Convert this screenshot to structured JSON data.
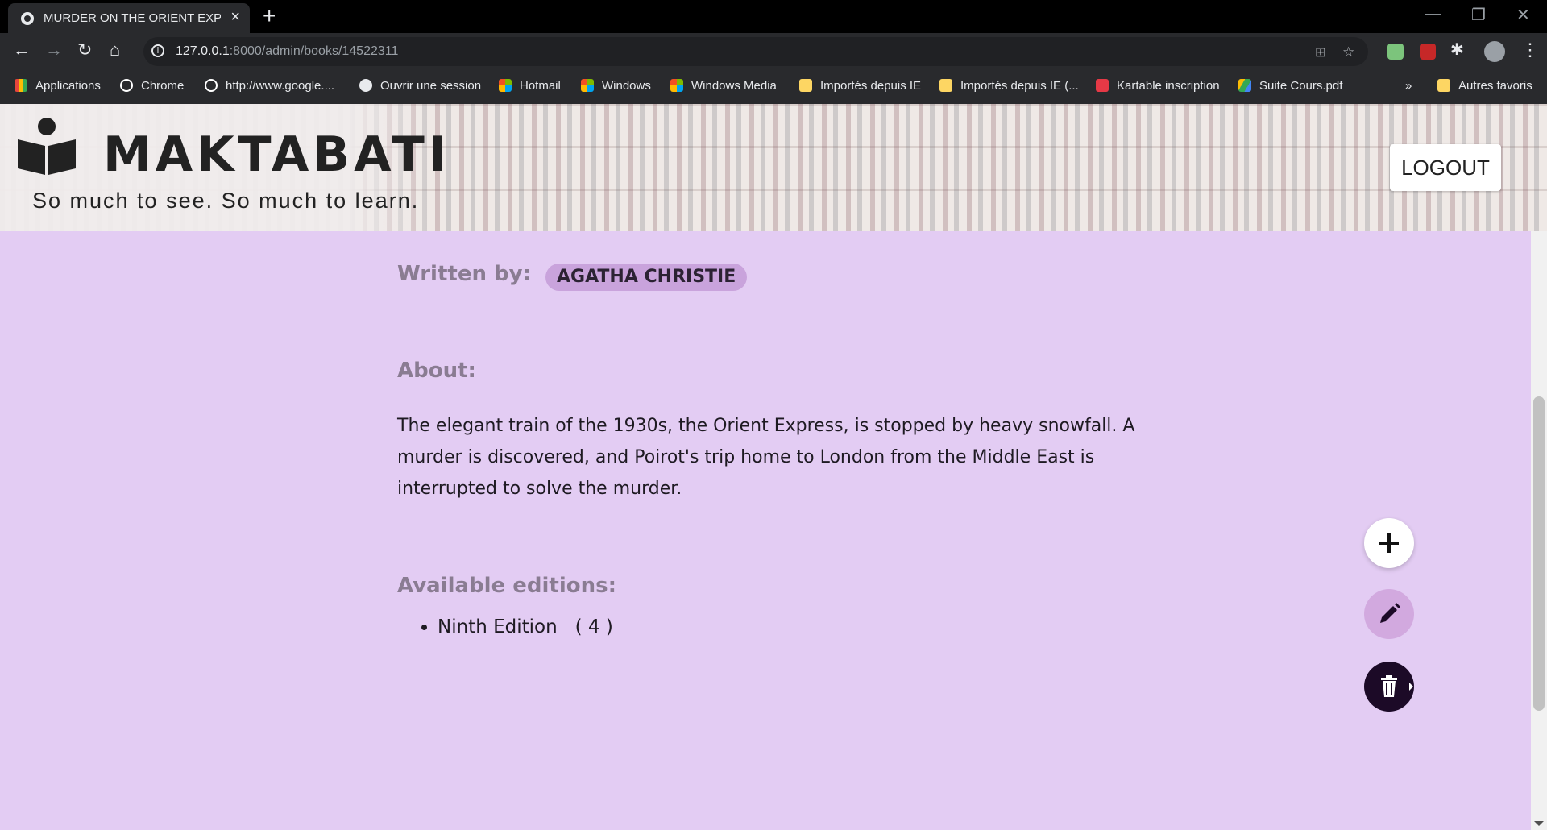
{
  "browser": {
    "tab_title": "MURDER ON THE ORIENT EXPRE",
    "url_host": "127.0.0.1",
    "url_rest": ":8000/admin/books/14522311",
    "bookmarks": [
      {
        "label": "Applications",
        "icon": "apps-grid-icon",
        "color": "#e8453c"
      },
      {
        "label": "Chrome",
        "icon": "google-icon",
        "color": "#ffffff"
      },
      {
        "label": "http://www.google....",
        "icon": "google-icon",
        "color": "#ffffff"
      },
      {
        "label": "Ouvrir une session",
        "icon": "globe-icon",
        "color": "#ffffff"
      },
      {
        "label": "Hotmail",
        "icon": "microsoft-icon",
        "color": "#f25022"
      },
      {
        "label": "Windows",
        "icon": "microsoft-icon",
        "color": "#f25022"
      },
      {
        "label": "Windows Media",
        "icon": "microsoft-icon",
        "color": "#f25022"
      },
      {
        "label": "Importés depuis IE",
        "icon": "folder-icon",
        "color": "#fdd663"
      },
      {
        "label": "Importés depuis IE (...",
        "icon": "folder-icon",
        "color": "#fdd663"
      },
      {
        "label": "Kartable inscription",
        "icon": "kartable-icon",
        "color": "#e63946"
      },
      {
        "label": "Suite Cours.pdf",
        "icon": "drive-icon",
        "color": "#34a853"
      }
    ],
    "more_bookmarks": "»",
    "other_bookmarks": "Autres favoris"
  },
  "header": {
    "brand": "MAKTABATI",
    "tagline": "So much to see. So much to learn.",
    "logout_label": "LOGOUT"
  },
  "book": {
    "written_by_label": "Written by:",
    "author": "AGATHA CHRISTIE",
    "about_label": "About:",
    "description": "The elegant train of the 1930s, the Orient Express, is stopped by heavy snowfall. A murder is discovered, and Poirot's trip home to London from the Middle East is interrupted to solve the murder.",
    "editions_label": "Available editions:",
    "editions": [
      {
        "name": "Ninth Edition",
        "count": "( 4 )"
      }
    ]
  },
  "actions": {
    "add_icon": "plus-icon",
    "edit_icon": "pencil-icon",
    "delete_icon": "trash-icon",
    "accent_color": "#1c0a27",
    "page_background": "#e3ccf3"
  }
}
